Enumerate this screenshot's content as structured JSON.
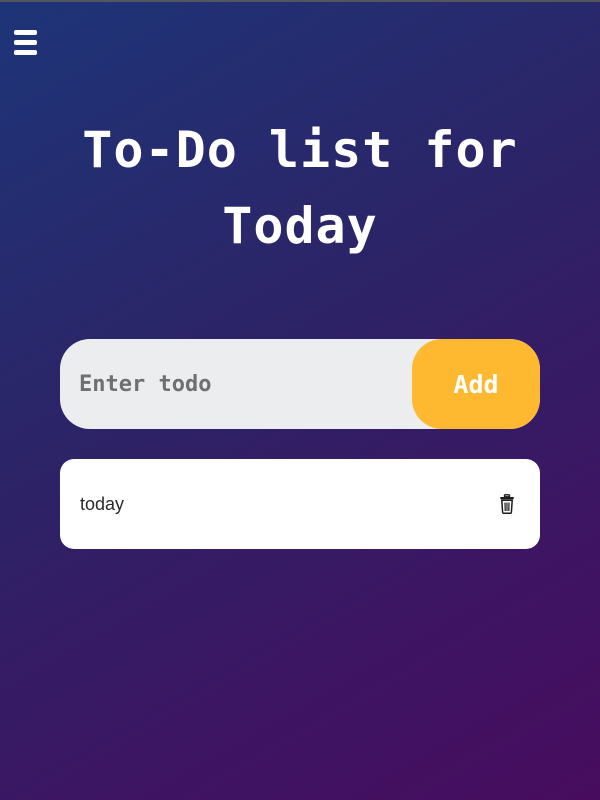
{
  "header": {
    "menu_icon": "hamburger-menu-icon"
  },
  "page": {
    "title": "To-Do list for Today"
  },
  "form": {
    "input_value": "",
    "input_placeholder": "Enter todo",
    "add_label": "Add"
  },
  "todos": {
    "items": [
      {
        "text": "today",
        "delete_icon": "trash-icon"
      }
    ]
  },
  "colors": {
    "background_start": "#1d3578",
    "background_end": "#480c5e",
    "accent": "#ffb931",
    "input_background": "#ecedee",
    "card_background": "#ffffff"
  }
}
